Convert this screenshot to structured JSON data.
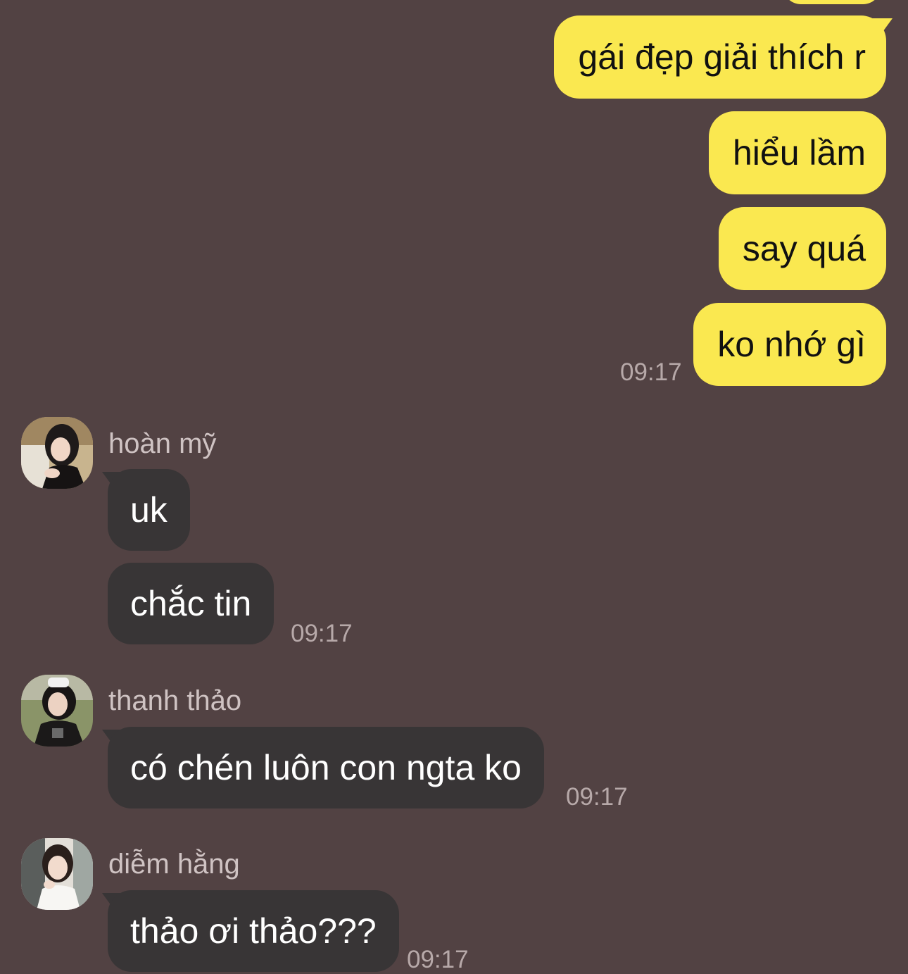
{
  "colors": {
    "background": "#524243",
    "outgoing_bubble": "#fae850",
    "incoming_bubble": "#383536",
    "timestamp": "#b7a9a9",
    "sender_name": "#cfc3c3"
  },
  "outgoing": {
    "messages": [
      {
        "text": "gái đẹp giải thích r"
      },
      {
        "text": "hiểu lầm"
      },
      {
        "text": "say quá"
      },
      {
        "text": "ko nhớ gì"
      }
    ],
    "time": "09:17"
  },
  "groups": [
    {
      "sender": "hoàn mỹ",
      "avatar_icon": "user-photo-avatar",
      "messages": [
        {
          "text": "uk"
        },
        {
          "text": "chắc tin"
        }
      ],
      "time": "09:17"
    },
    {
      "sender": "thanh thảo",
      "avatar_icon": "user-photo-avatar",
      "messages": [
        {
          "text": "có chén luôn con ngta ko"
        }
      ],
      "time": "09:17"
    },
    {
      "sender": "diễm hằng",
      "avatar_icon": "user-photo-avatar",
      "messages": [
        {
          "text": "thảo ơi thảo???"
        }
      ],
      "time": "09:17"
    }
  ]
}
